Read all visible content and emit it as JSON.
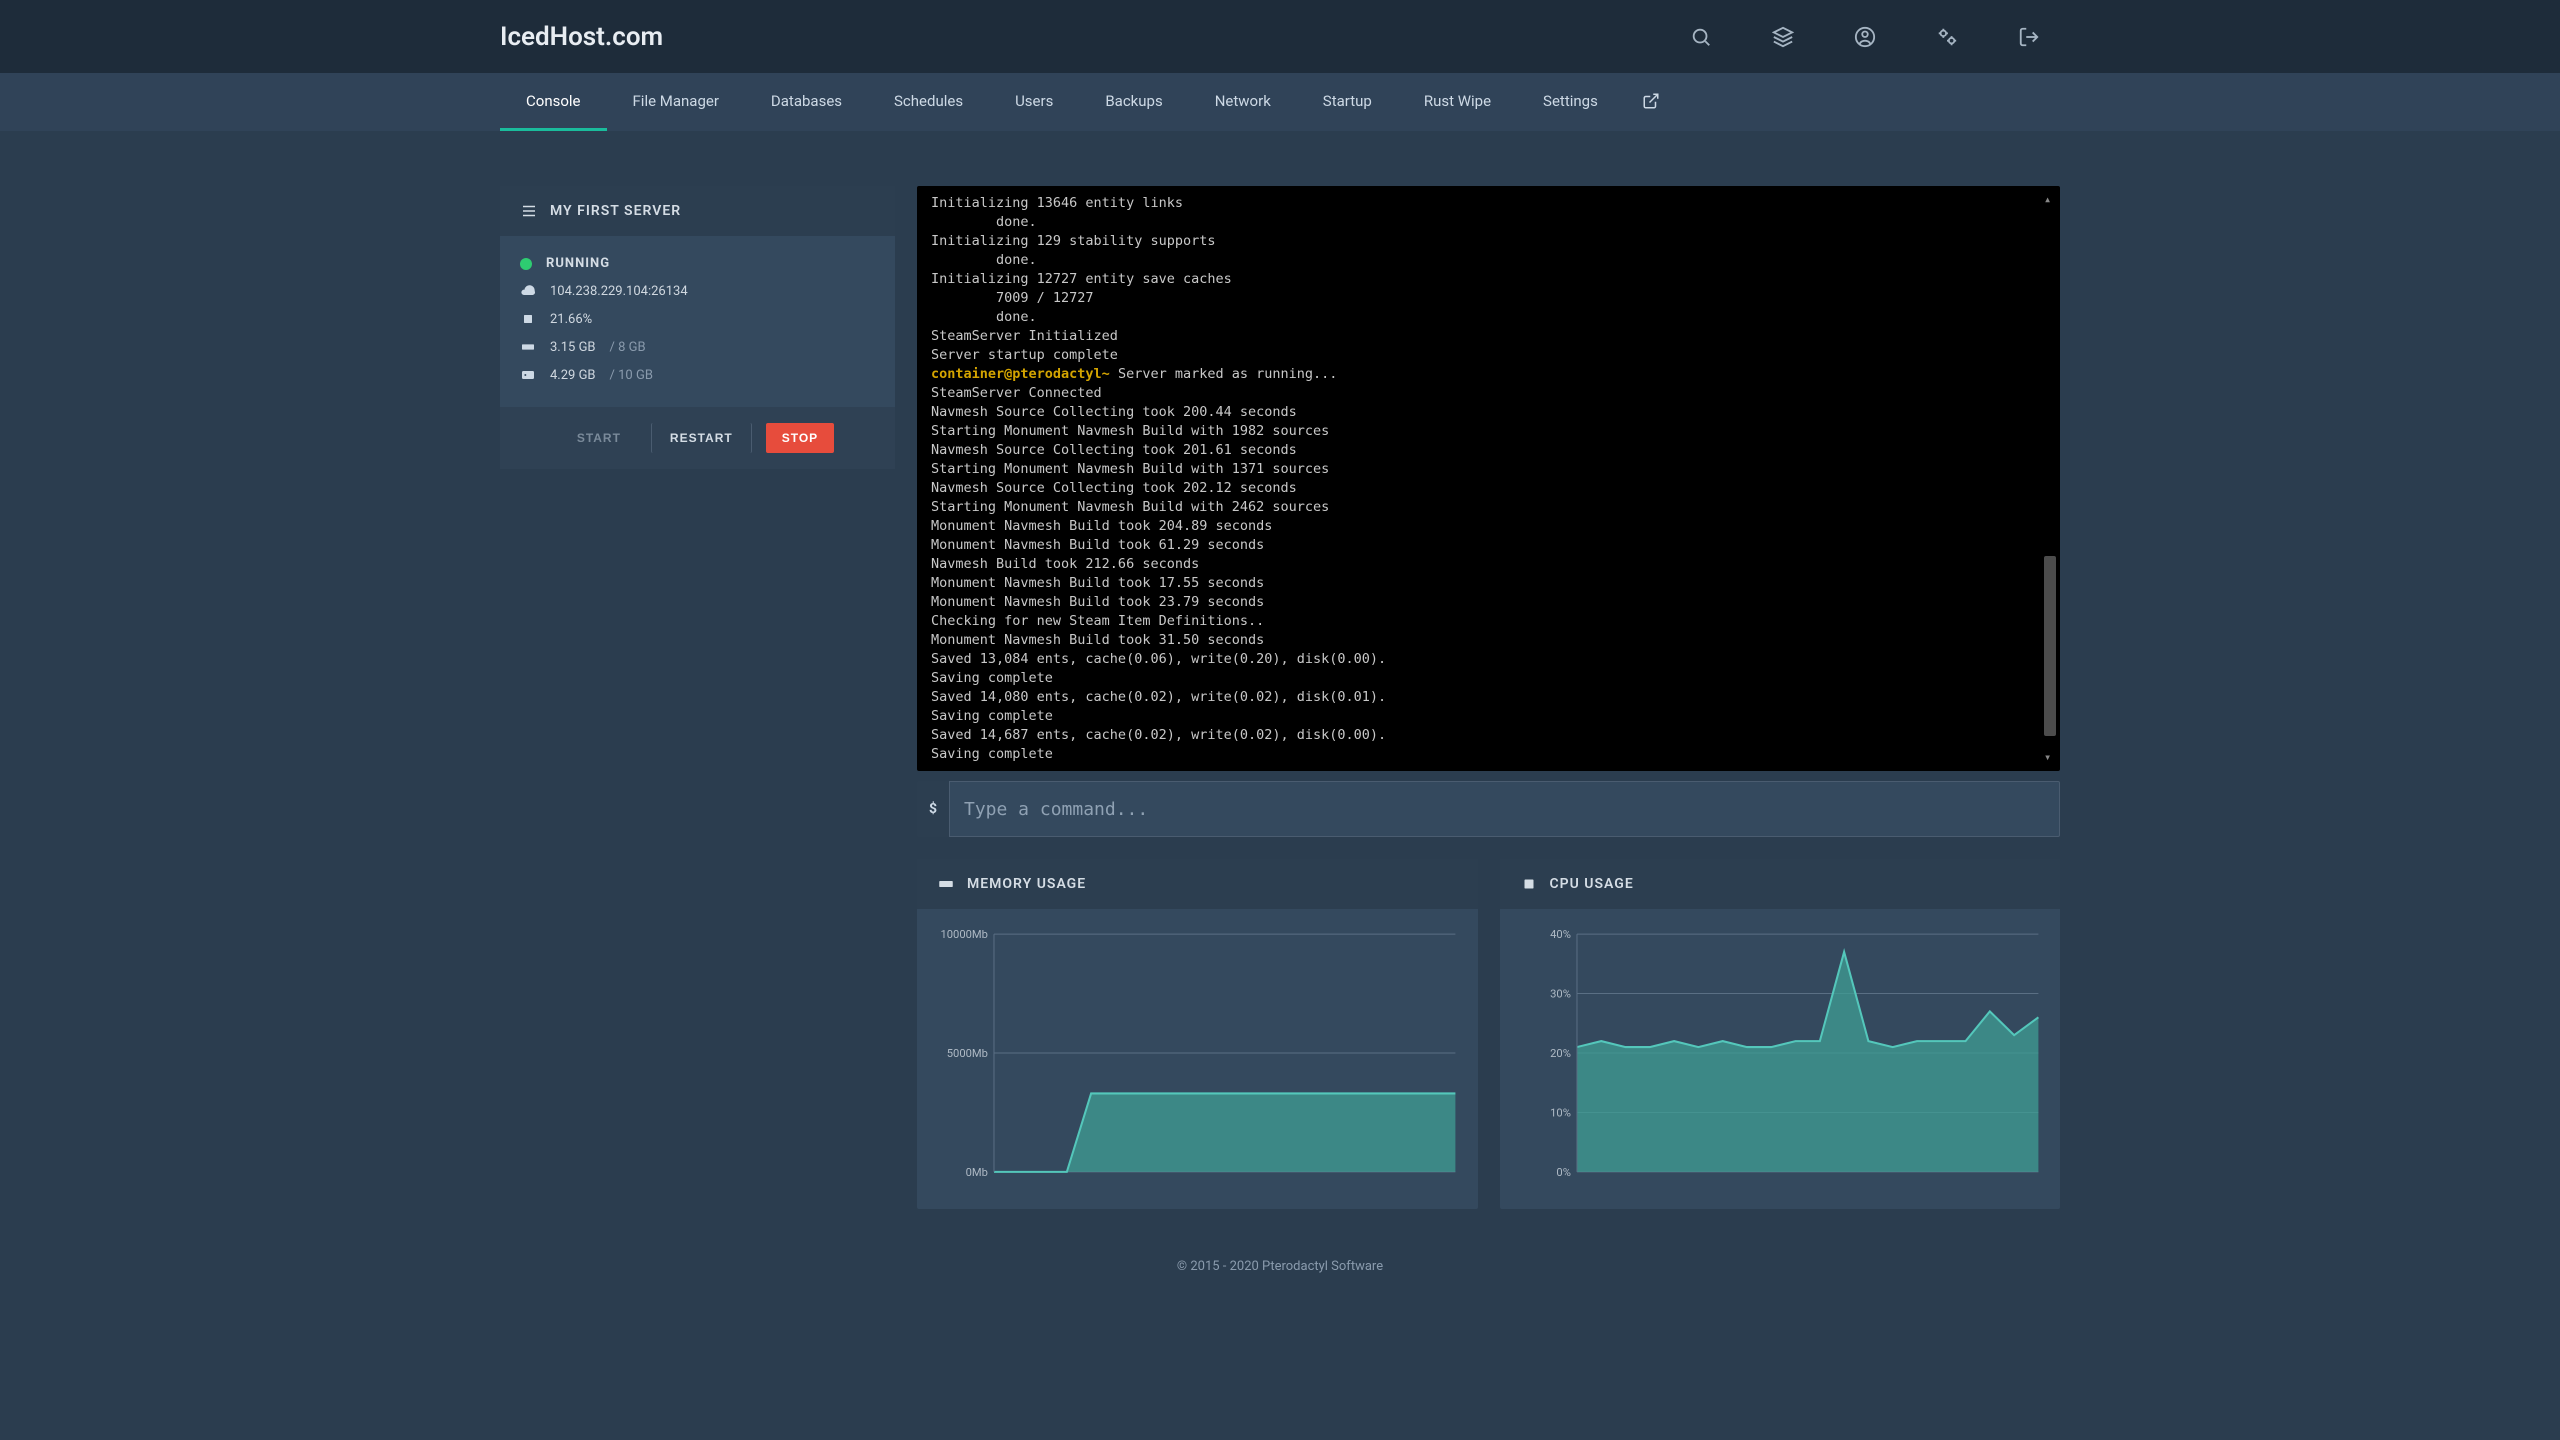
{
  "brand": "IcedHost.com",
  "tabs": [
    "Console",
    "File Manager",
    "Databases",
    "Schedules",
    "Users",
    "Backups",
    "Network",
    "Startup",
    "Rust Wipe",
    "Settings"
  ],
  "active_tab": 0,
  "server": {
    "name": "MY FIRST SERVER",
    "status": "RUNNING",
    "ip": "104.238.229.104:26134",
    "cpu": "21.66%",
    "mem_used": "3.15 GB",
    "mem_total": "8 GB",
    "disk_used": "4.29 GB",
    "disk_total": "10 GB",
    "start_label": "START",
    "restart_label": "RESTART",
    "stop_label": "STOP"
  },
  "console_lines": [
    "Initializing 13646 entity links",
    "        done.",
    "Initializing 129 stability supports",
    "        done.",
    "Initializing 12727 entity save caches",
    "        7009 / 12727",
    "        done.",
    "SteamServer Initialized",
    "Server startup complete",
    "container@pterodactyl~ Server marked as running...",
    "SteamServer Connected",
    "Navmesh Source Collecting took 200.44 seconds",
    "Starting Monument Navmesh Build with 1982 sources",
    "Navmesh Source Collecting took 201.61 seconds",
    "Starting Monument Navmesh Build with 1371 sources",
    "Navmesh Source Collecting took 202.12 seconds",
    "Starting Monument Navmesh Build with 2462 sources",
    "Monument Navmesh Build took 204.89 seconds",
    "Monument Navmesh Build took 61.29 seconds",
    "Navmesh Build took 212.66 seconds",
    "Monument Navmesh Build took 17.55 seconds",
    "Monument Navmesh Build took 23.79 seconds",
    "Checking for new Steam Item Definitions..",
    "Monument Navmesh Build took 31.50 seconds",
    "Saved 13,084 ents, cache(0.06), write(0.20), disk(0.00).",
    "Saving complete",
    "Saved 14,080 ents, cache(0.02), write(0.02), disk(0.01).",
    "Saving complete",
    "Saved 14,687 ents, cache(0.02), write(0.02), disk(0.00).",
    "Saving complete"
  ],
  "console_highlight_prefix": "container@pterodactyl~",
  "cmd_prompt": "$",
  "cmd_placeholder": "Type a command...",
  "memory_chart_title": "MEMORY USAGE",
  "cpu_chart_title": "CPU USAGE",
  "footer": "© 2015 - 2020 Pterodactyl Software",
  "chart_data": [
    {
      "type": "area",
      "title": "MEMORY USAGE",
      "ylabel": "Mb",
      "ylim": [
        0,
        10000
      ],
      "yticks": [
        0,
        5000,
        10000
      ],
      "ytick_labels": [
        "0Mb",
        "5000Mb",
        "10000Mb"
      ],
      "x": [
        0,
        1,
        2,
        3,
        4,
        5,
        6,
        7,
        8,
        9,
        10,
        11,
        12,
        13,
        14,
        15,
        16,
        17,
        18,
        19
      ],
      "values": [
        0,
        0,
        0,
        0,
        3300,
        3300,
        3300,
        3300,
        3300,
        3300,
        3300,
        3300,
        3300,
        3300,
        3300,
        3300,
        3300,
        3300,
        3300,
        3300
      ],
      "color": "#3f9e94"
    },
    {
      "type": "area",
      "title": "CPU USAGE",
      "ylabel": "%",
      "ylim": [
        0,
        40
      ],
      "yticks": [
        0,
        10,
        20,
        30,
        40
      ],
      "ytick_labels": [
        "0%",
        "10%",
        "20%",
        "30%",
        "40%"
      ],
      "x": [
        0,
        1,
        2,
        3,
        4,
        5,
        6,
        7,
        8,
        9,
        10,
        11,
        12,
        13,
        14,
        15,
        16,
        17,
        18,
        19
      ],
      "values": [
        21,
        22,
        21,
        21,
        22,
        21,
        22,
        21,
        21,
        22,
        22,
        37,
        22,
        21,
        22,
        22,
        22,
        27,
        23,
        26
      ],
      "color": "#3f9e94"
    }
  ]
}
